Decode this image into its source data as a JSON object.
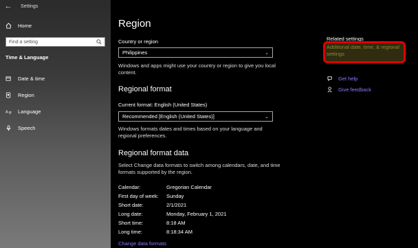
{
  "window": {
    "app_title": "Settings",
    "controls": {
      "minimize": "—",
      "maximize": "☐",
      "close": "✕"
    }
  },
  "sidebar": {
    "back_glyph": "←",
    "home_label": "Home",
    "search_placeholder": "Find a setting",
    "section_title": "Time & Language",
    "items": [
      {
        "label": "Date & time",
        "icon": "calendar-clock-icon"
      },
      {
        "label": "Region",
        "icon": "globe-icon"
      },
      {
        "label": "Language",
        "icon": "language-icon"
      },
      {
        "label": "Speech",
        "icon": "microphone-icon"
      }
    ]
  },
  "main": {
    "title": "Region",
    "country_label": "Country or region",
    "country_value": "Philippines",
    "country_desc": "Windows and apps might use your country or region to give you local content.",
    "regional_format_title": "Regional format",
    "current_format": "Current format: English (United States)",
    "format_value": "Recommended [English (United States)]",
    "format_desc": "Windows formats dates and times based on your language and regional preferences.",
    "format_data_title": "Regional format data",
    "format_data_desc": "Select Change data formats to switch among calendars, date, and time formats supported by the region.",
    "format_rows": [
      {
        "key": "Calendar:",
        "value": "Gregorian Calendar"
      },
      {
        "key": "First day of week:",
        "value": "Sunday"
      },
      {
        "key": "Short date:",
        "value": "2/1/2021"
      },
      {
        "key": "Long date:",
        "value": "Monday, February 1, 2021"
      },
      {
        "key": "Short time:",
        "value": "8:18 AM"
      },
      {
        "key": "Long time:",
        "value": "8:18:34 AM"
      }
    ],
    "change_link": "Change data formats"
  },
  "related": {
    "title": "Related settings",
    "link_line1": "Additional date, time, & regional",
    "link_line2": "settings",
    "get_help": "Get help",
    "give_feedback": "Give feedback"
  },
  "colors": {
    "accent_link": "#8a7cff",
    "highlight_border": "#e00000"
  }
}
